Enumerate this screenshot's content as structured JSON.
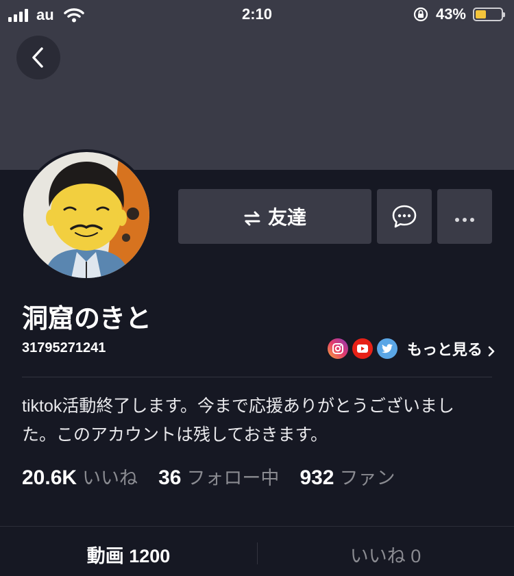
{
  "status_bar": {
    "carrier": "au",
    "time": "2:10",
    "battery_percent": "43%",
    "battery_level": 0.43
  },
  "profile": {
    "username": "洞窟のきと",
    "user_id": "31795271241",
    "friend_button_label": "友達",
    "more_link_label": "もっと見る",
    "bio": "tiktok活動終了します。今まで応援ありがとうございました。このアカウントは残しておきます。",
    "social_icons": [
      "instagram-icon",
      "youtube-icon",
      "twitter-icon"
    ]
  },
  "stats": [
    {
      "value": "20.6K",
      "label": "いいね"
    },
    {
      "value": "36",
      "label": "フォロー中"
    },
    {
      "value": "932",
      "label": "ファン"
    }
  ],
  "tabs": {
    "videos": "動画 1200",
    "likes": "いいね 0"
  },
  "colors": {
    "background": "#161823",
    "header": "#3a3b47",
    "button": "#3a3b47",
    "battery": "#f4c53b"
  }
}
